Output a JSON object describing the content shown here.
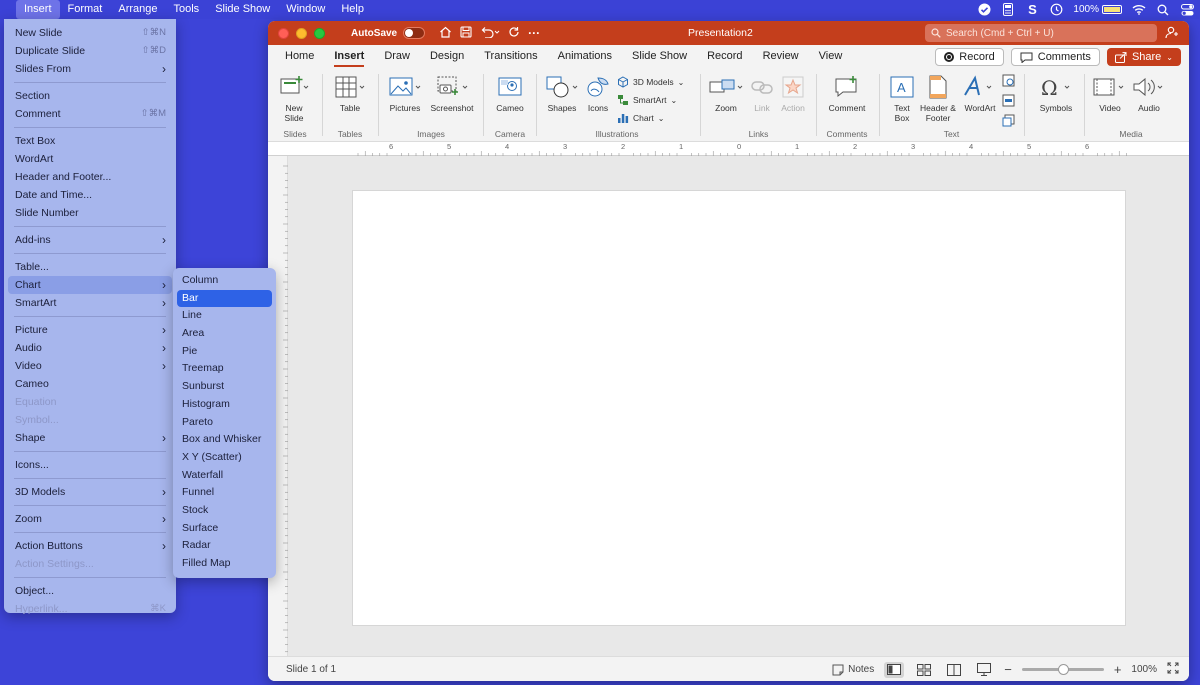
{
  "menubar": {
    "items": [
      "Insert",
      "Format",
      "Arrange",
      "Tools",
      "Slide Show",
      "Window",
      "Help"
    ],
    "active": "Insert",
    "battery_label": "100%"
  },
  "insert_menu": {
    "groups": [
      [
        {
          "label": "New Slide",
          "shortcut": "⇧⌘N"
        },
        {
          "label": "Duplicate Slide",
          "shortcut": "⇧⌘D"
        },
        {
          "label": "Slides From",
          "submenu": true
        }
      ],
      [
        {
          "label": "Section"
        },
        {
          "label": "Comment",
          "shortcut": "⇧⌘M"
        }
      ],
      [
        {
          "label": "Text Box"
        },
        {
          "label": "WordArt"
        },
        {
          "label": "Header and Footer..."
        },
        {
          "label": "Date and Time..."
        },
        {
          "label": "Slide Number"
        }
      ],
      [
        {
          "label": "Add-ins",
          "submenu": true
        }
      ],
      [
        {
          "label": "Table..."
        },
        {
          "label": "Chart",
          "submenu": true,
          "highlighted": true
        },
        {
          "label": "SmartArt",
          "submenu": true
        }
      ],
      [
        {
          "label": "Picture",
          "submenu": true
        },
        {
          "label": "Audio",
          "submenu": true
        },
        {
          "label": "Video",
          "submenu": true
        },
        {
          "label": "Cameo"
        },
        {
          "label": "Equation",
          "disabled": true
        },
        {
          "label": "Symbol...",
          "disabled": true
        },
        {
          "label": "Shape",
          "submenu": true
        }
      ],
      [
        {
          "label": "Icons..."
        }
      ],
      [
        {
          "label": "3D Models",
          "submenu": true
        }
      ],
      [
        {
          "label": "Zoom",
          "submenu": true
        }
      ],
      [
        {
          "label": "Action Buttons",
          "submenu": true
        },
        {
          "label": "Action Settings...",
          "disabled": true
        }
      ],
      [
        {
          "label": "Object..."
        },
        {
          "label": "Hyperlink...",
          "shortcut": "⌘K",
          "disabled": true
        }
      ]
    ]
  },
  "chart_submenu": {
    "items": [
      "Column",
      "Bar",
      "Line",
      "Area",
      "Pie",
      "Treemap",
      "Sunburst",
      "Histogram",
      "Pareto",
      "Box and Whisker",
      "X Y (Scatter)",
      "Waterfall",
      "Funnel",
      "Stock",
      "Surface",
      "Radar",
      "Filled Map"
    ],
    "selected": "Bar"
  },
  "window": {
    "autosave_label": "AutoSave",
    "title": "Presentation2",
    "search_placeholder": "Search (Cmd + Ctrl + U)"
  },
  "ribbon_tabs": [
    "Home",
    "Insert",
    "Draw",
    "Design",
    "Transitions",
    "Animations",
    "Slide Show",
    "Record",
    "Review",
    "View"
  ],
  "active_tab": "Insert",
  "tab_actions": {
    "record": "Record",
    "comments": "Comments",
    "share": "Share"
  },
  "ribbon": {
    "new_slide": "New Slide",
    "slides_group": "Slides",
    "table": "Table",
    "tables_group": "Tables",
    "pictures": "Pictures",
    "screenshot": "Screenshot",
    "images_group": "Images",
    "cameo": "Cameo",
    "camera_group": "Camera",
    "shapes": "Shapes",
    "icons": "Icons",
    "models_3d": "3D Models",
    "smartart": "SmartArt",
    "chart": "Chart",
    "illustrations_group": "Illustrations",
    "zoom": "Zoom",
    "link": "Link",
    "action": "Action",
    "links_group": "Links",
    "comment": "Comment",
    "comments_group": "Comments",
    "text_box": "Text Box",
    "header_footer": "Header & Footer",
    "wordart": "WordArt",
    "text_group": "Text",
    "symbols": "Symbols",
    "video": "Video",
    "audio": "Audio",
    "media_group": "Media"
  },
  "ruler_labels": [
    "6",
    "5",
    "4",
    "3",
    "2",
    "1",
    "0",
    "1",
    "2",
    "3",
    "4",
    "5",
    "6"
  ],
  "statusbar": {
    "slide_info": "Slide 1 of 1",
    "notes": "Notes",
    "zoom": "100%"
  }
}
